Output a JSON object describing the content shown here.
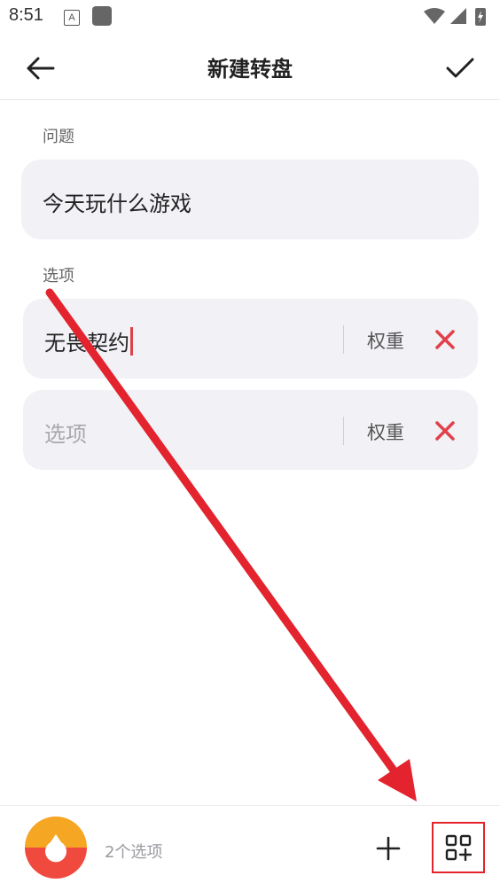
{
  "status_bar": {
    "time": "8:51",
    "a_icon": "A"
  },
  "header": {
    "title": "新建转盘"
  },
  "question": {
    "label": "问题",
    "value": "今天玩什么游戏"
  },
  "options": {
    "label": "选项",
    "weight_label": "权重",
    "placeholder": "选项",
    "items": [
      {
        "value": "无畏契约",
        "weight_label": "权重"
      },
      {
        "value": "",
        "weight_label": "权重"
      }
    ]
  },
  "footer": {
    "count_text": "2个选项"
  },
  "colors": {
    "accent_red": "#e3232d",
    "wheel_orange": "#f5a623",
    "wheel_red": "#f0493e",
    "field_bg": "#f1f1f6"
  },
  "icons": [
    "back-arrow-icon",
    "check-icon",
    "close-icon",
    "plus-icon",
    "grid-add-icon"
  ]
}
